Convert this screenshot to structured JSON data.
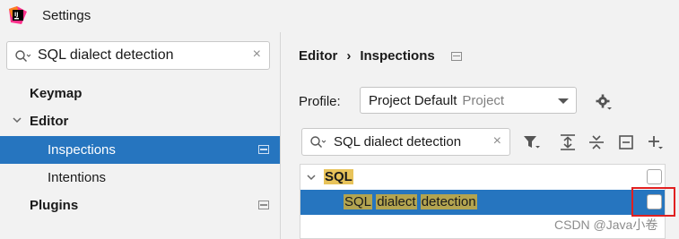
{
  "window": {
    "title": "Settings",
    "app_icon": "intellij-logo-icon"
  },
  "left_search": {
    "value": "SQL dialect detection",
    "icon": "search-icon",
    "clear": "×"
  },
  "nav": [
    {
      "label": "Keymap"
    },
    {
      "label": "Editor",
      "expanded": true
    },
    {
      "label": "Inspections",
      "selected": true
    },
    {
      "label": "Intentions"
    },
    {
      "label": "Plugins"
    }
  ],
  "breadcrumb": {
    "first": "Editor",
    "separator": "›",
    "second": "Inspections"
  },
  "profile": {
    "label": "Profile:",
    "value": "Project Default",
    "scope": "Project"
  },
  "tree_search": {
    "value": "SQL dialect detection",
    "clear": "×"
  },
  "toolbar": [
    "filter-icon",
    "expand-all-icon",
    "collapse-all-icon",
    "reset-icon",
    "add-icon"
  ],
  "tree": {
    "group": {
      "label": "SQL",
      "checked": false
    },
    "item": {
      "words": [
        "SQL",
        "dialect",
        "detection"
      ],
      "checked": false,
      "selected": true
    }
  },
  "watermark": "CSDN @Java小卷",
  "colors": {
    "selection": "#2675bf",
    "highlight": "#e8c35a",
    "callout": "#e02020"
  }
}
